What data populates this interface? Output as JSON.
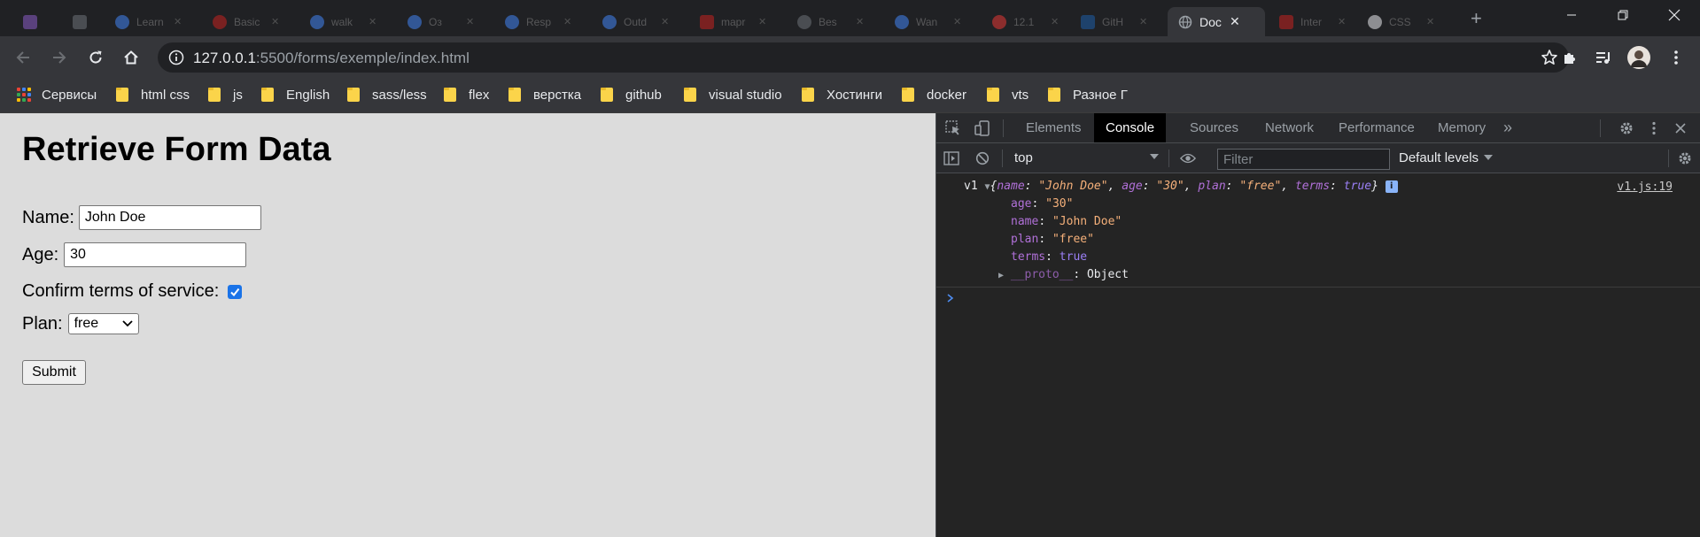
{
  "tabs": [
    {
      "title": "",
      "active": false
    },
    {
      "title": "",
      "active": false
    },
    {
      "title": "Learn",
      "active": false
    },
    {
      "title": "Basic",
      "active": false
    },
    {
      "title": "walk",
      "active": false
    },
    {
      "title": "Оз",
      "active": false
    },
    {
      "title": "Resp",
      "active": false
    },
    {
      "title": "Outd",
      "active": false
    },
    {
      "title": "mapr",
      "active": false
    },
    {
      "title": "Bes",
      "active": false
    },
    {
      "title": "Wan",
      "active": false
    },
    {
      "title": "12.1",
      "active": false
    },
    {
      "title": "GitH",
      "active": false
    },
    {
      "title": "Doc",
      "active": true
    },
    {
      "title": "Inter",
      "active": false
    },
    {
      "title": "CSS",
      "active": false
    }
  ],
  "address": {
    "host": "127.0.0.1",
    "rest": ":5500/forms/exemple/index.html"
  },
  "bookmarks": {
    "apps_label": "Сервисы",
    "folders": [
      "html css",
      "js",
      "English",
      "sass/less",
      "flex",
      "верстка",
      "github",
      "visual studio",
      "Хостинги",
      "docker",
      "vts",
      "Разное Г"
    ]
  },
  "page": {
    "heading": "Retrieve Form Data",
    "name_label": "Name:",
    "name_value": "John Doe",
    "age_label": "Age:",
    "age_value": "30",
    "terms_label": "Confirm terms of service:",
    "terms_checked": true,
    "plan_label": "Plan:",
    "plan_value": "free",
    "submit_label": "Submit"
  },
  "devtools": {
    "tabs": [
      "Elements",
      "Console",
      "Sources",
      "Network",
      "Performance",
      "Memory"
    ],
    "active_tab": "Console",
    "more": "»",
    "context": "top",
    "filter_placeholder": "Filter",
    "levels": "Default levels",
    "log": {
      "prefix": "v1",
      "source": "v1.js:19",
      "summary": {
        "open": "{",
        "k1": "name",
        "v1": "\"John Doe\"",
        "k2": "age",
        "v2": "\"30\"",
        "k3": "plan",
        "v3": "\"free\"",
        "k4": "terms",
        "v4": "true",
        "close": "}"
      },
      "props": [
        {
          "key": "age",
          "value": "\"30\"",
          "kind": "str"
        },
        {
          "key": "name",
          "value": "\"John Doe\"",
          "kind": "str"
        },
        {
          "key": "plan",
          "value": "\"free\"",
          "kind": "str"
        },
        {
          "key": "terms",
          "value": "true",
          "kind": "bool"
        }
      ],
      "proto_key": "__proto__",
      "proto_value": "Object"
    }
  }
}
